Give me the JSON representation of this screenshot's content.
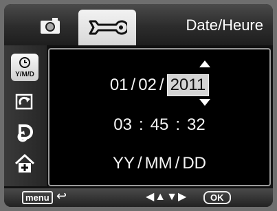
{
  "header": {
    "title": "Date/Heure",
    "tabs": [
      {
        "name": "camera",
        "icon": "camera-icon"
      },
      {
        "name": "settings",
        "icon": "wrench-icon",
        "selected": true
      }
    ]
  },
  "sidebar": {
    "items": [
      {
        "icon": "clock-date-icon",
        "label": "Y/M/D",
        "active": true
      },
      {
        "icon": "rotate-icon"
      },
      {
        "icon": "language-icon"
      },
      {
        "icon": "home-icon"
      }
    ]
  },
  "datetime": {
    "day": "01",
    "month": "02",
    "year": "2011",
    "hour": "03",
    "minute": "45",
    "second": "32",
    "format": [
      "YY",
      "MM",
      "DD"
    ],
    "date_sep": "/",
    "time_sep": ":"
  },
  "footer": {
    "menu_label": "menu",
    "nav_keys": "◀▲▼▶",
    "ok_label": "OK"
  }
}
